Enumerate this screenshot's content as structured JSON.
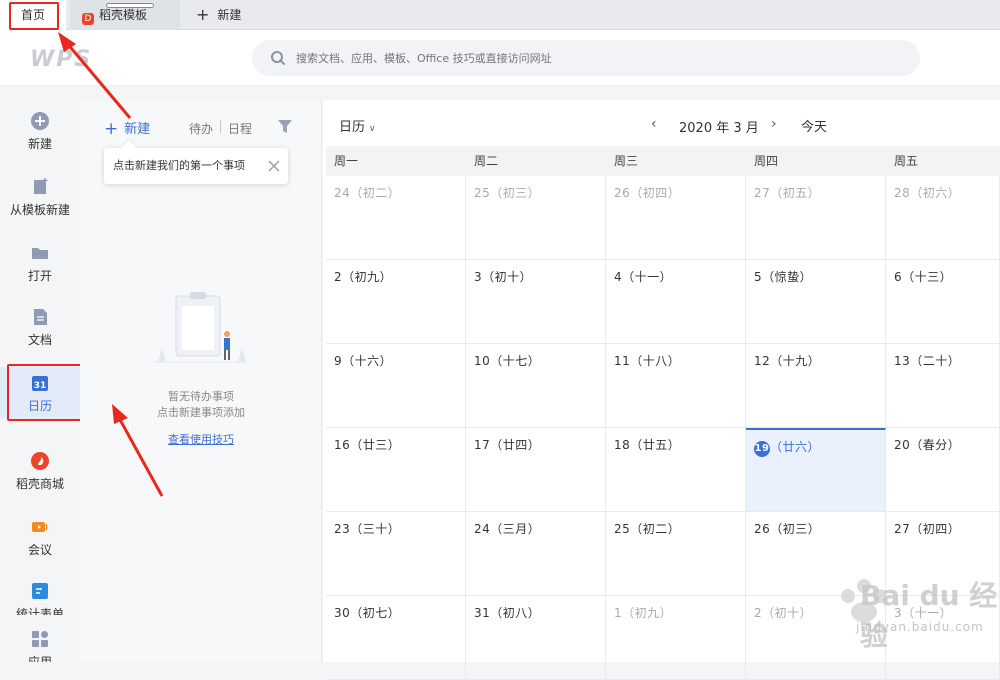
{
  "tabs": {
    "home": "首页",
    "daoke": "稻壳模板",
    "new_tab": "新建"
  },
  "header": {
    "brand": "WPS",
    "search_placeholder": "搜索文档、应用、模板、Office 技巧或直接访问网址"
  },
  "sidebar": {
    "items": [
      {
        "label": "新建",
        "icon": "plus-circle-icon"
      },
      {
        "label": "从模板新建",
        "icon": "template-icon"
      },
      {
        "label": "打开",
        "icon": "folder-icon"
      },
      {
        "label": "文档",
        "icon": "document-icon"
      },
      {
        "label": "日历",
        "icon": "calendar-icon"
      },
      {
        "label": "稻壳商城",
        "icon": "daoke-store-icon"
      },
      {
        "label": "会议",
        "icon": "meeting-icon"
      },
      {
        "label": "统计表单",
        "icon": "form-icon"
      },
      {
        "label": "应用",
        "icon": "apps-icon"
      }
    ]
  },
  "todo": {
    "new_label": "新建",
    "tab_todo": "待办",
    "tab_schedule": "日程",
    "tooltip": "点击新建我们的第一个事项",
    "empty_line1": "暂无待办事项",
    "empty_line2": "点击新建事项添加",
    "tips_link": "查看使用技巧"
  },
  "calendar": {
    "view_label": "日历",
    "month": "2020 年 3 月",
    "today_label": "今天",
    "weekdays": [
      "周一",
      "周二",
      "周三",
      "周四",
      "周五"
    ],
    "rows": [
      [
        "24（初二）",
        "25（初三）",
        "26（初四）",
        "27（初五）",
        "28（初六）"
      ],
      [
        "2（初九）",
        "3（初十）",
        "4（十一）",
        "5（惊蛰）",
        "6（十三）"
      ],
      [
        "9（十六）",
        "10（十七）",
        "11（十八）",
        "12（十九）",
        "13（二十）"
      ],
      [
        "16（廿三）",
        "17（廿四）",
        "18（廿五）",
        "（廿六）",
        "20（春分）"
      ],
      [
        "23（三十）",
        "24（三月）",
        "25（初二）",
        "26（初三）",
        "27（初四）"
      ],
      [
        "30（初七）",
        "31（初八）",
        "1（初九）",
        "2（初十）",
        "3（十一）"
      ]
    ],
    "today_day": "19",
    "accent": "#3b6fd8"
  },
  "watermark": {
    "text": "Bai du 经验",
    "url": "jingyan.baidu.com"
  }
}
